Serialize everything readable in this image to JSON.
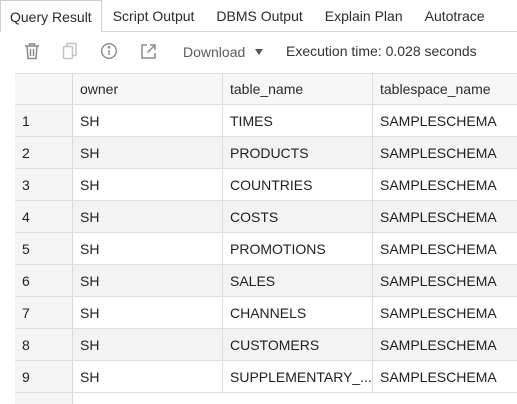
{
  "tabs": [
    {
      "label": "Query Result",
      "active": true
    },
    {
      "label": "Script Output",
      "active": false
    },
    {
      "label": "DBMS Output",
      "active": false
    },
    {
      "label": "Explain Plan",
      "active": false
    },
    {
      "label": "Autotrace",
      "active": false
    }
  ],
  "toolbar": {
    "icons": [
      "trash-icon",
      "copy-icon",
      "info-icon",
      "open-external-icon"
    ],
    "download_label": "Download",
    "execution_time": "Execution time: 0.028 seconds"
  },
  "grid": {
    "columns": [
      "owner",
      "table_name",
      "tablespace_name"
    ],
    "rows": [
      {
        "num": "1",
        "owner": "SH",
        "table_name": "TIMES",
        "tablespace_name": "SAMPLESCHEMA"
      },
      {
        "num": "2",
        "owner": "SH",
        "table_name": "PRODUCTS",
        "tablespace_name": "SAMPLESCHEMA"
      },
      {
        "num": "3",
        "owner": "SH",
        "table_name": "COUNTRIES",
        "tablespace_name": "SAMPLESCHEMA"
      },
      {
        "num": "4",
        "owner": "SH",
        "table_name": "COSTS",
        "tablespace_name": "SAMPLESCHEMA"
      },
      {
        "num": "5",
        "owner": "SH",
        "table_name": "PROMOTIONS",
        "tablespace_name": "SAMPLESCHEMA"
      },
      {
        "num": "6",
        "owner": "SH",
        "table_name": "SALES",
        "tablespace_name": "SAMPLESCHEMA"
      },
      {
        "num": "7",
        "owner": "SH",
        "table_name": "CHANNELS",
        "tablespace_name": "SAMPLESCHEMA"
      },
      {
        "num": "8",
        "owner": "SH",
        "table_name": "CUSTOMERS",
        "tablespace_name": "SAMPLESCHEMA"
      },
      {
        "num": "9",
        "owner": "SH",
        "table_name": "SUPPLEMENTARY_...",
        "tablespace_name": "SAMPLESCHEMA"
      }
    ]
  },
  "colors": {
    "row_shade": "#f3f3f3",
    "grid_line": "#dedede",
    "icon_gray": "#8a8a8a"
  }
}
